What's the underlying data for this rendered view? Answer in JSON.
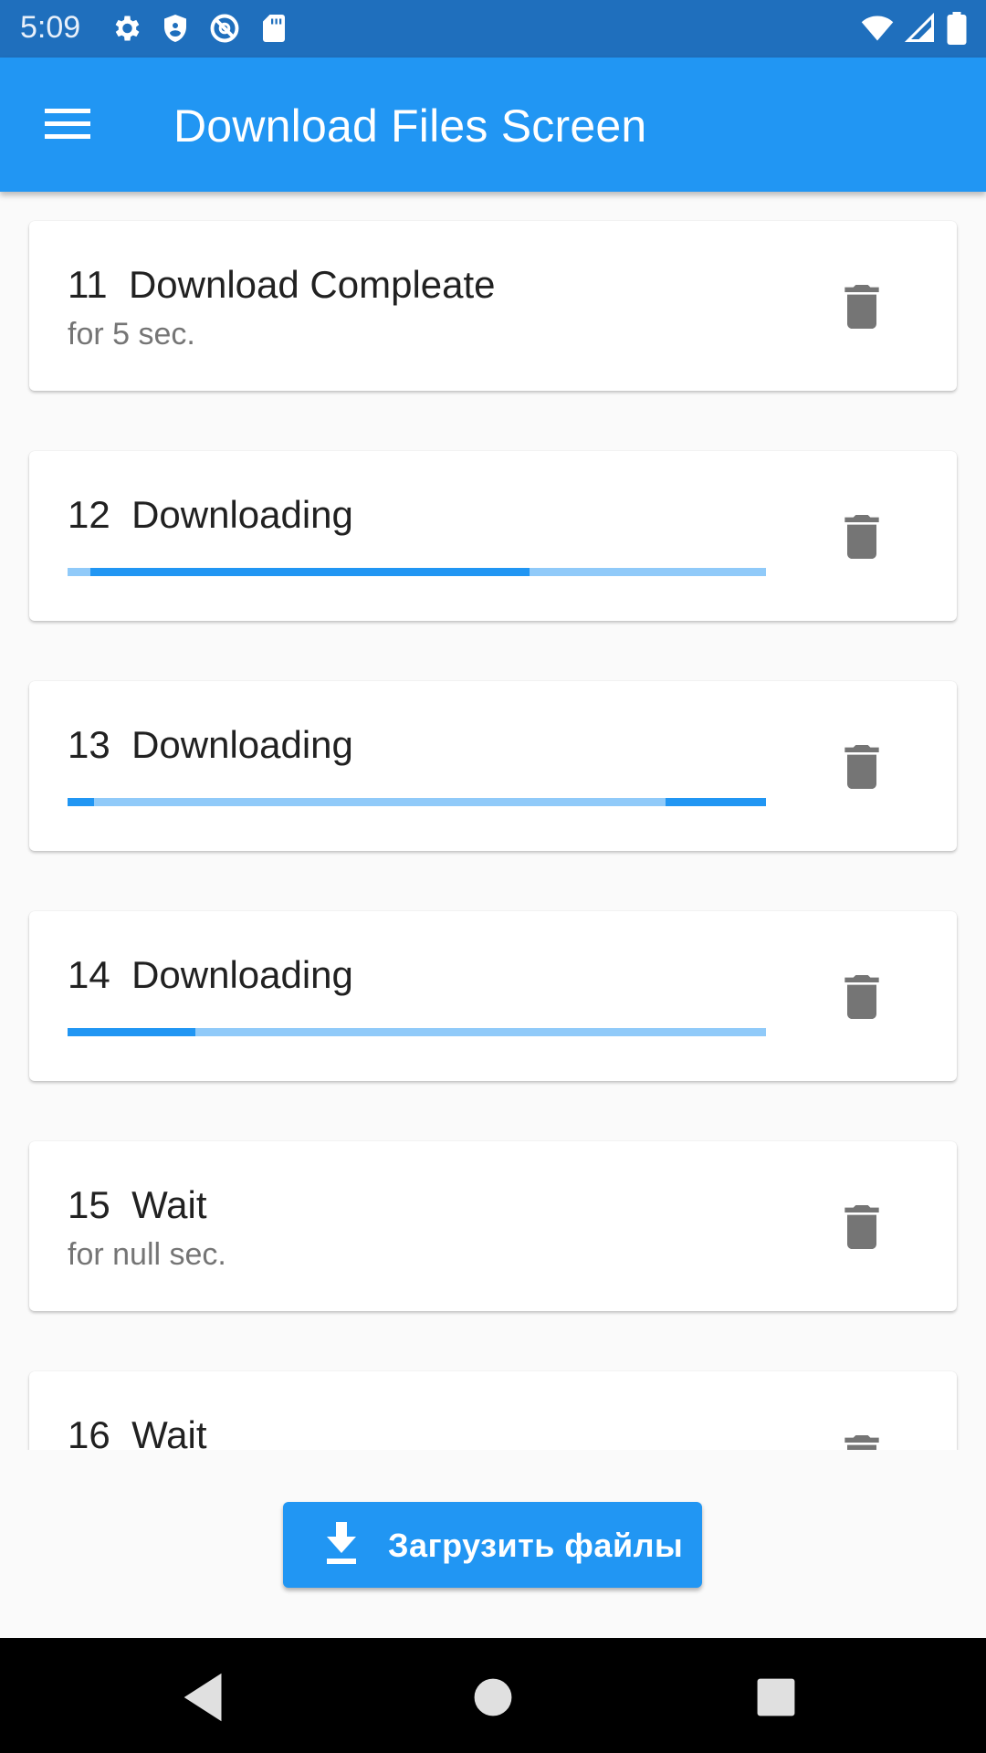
{
  "status_bar": {
    "time": "5:09",
    "icons_left": [
      "settings-icon",
      "shield-icon",
      "do-not-disturb-icon",
      "sd-card-icon"
    ],
    "icons_right": [
      "wifi-icon",
      "cell-signal-icon",
      "battery-icon"
    ]
  },
  "app_bar": {
    "menu_icon": "hamburger-menu-icon",
    "title": "Download Files Screen"
  },
  "colors": {
    "primary": "#2196f3",
    "status_bar": "#1f6fbd",
    "progress_track": "#90caf9",
    "delete_icon": "#757575"
  },
  "items": [
    {
      "number": "11",
      "status": "Download Compleate",
      "subtitle": "for 5 sec."
    },
    {
      "number": "12",
      "status": "Downloading",
      "progress": "indeterminate"
    },
    {
      "number": "13",
      "status": "Downloading",
      "progress": "indeterminate"
    },
    {
      "number": "14",
      "status": "Downloading",
      "progress": "indeterminate"
    },
    {
      "number": "15",
      "status": "Wait",
      "subtitle": "for null sec."
    },
    {
      "number": "16",
      "status": "Wait"
    }
  ],
  "delete_icon": "trash-icon",
  "download_button": {
    "icon": "download-icon",
    "label": "Загрузить файлы"
  },
  "nav_bar": {
    "icons": [
      "back-icon",
      "home-icon",
      "recents-icon"
    ]
  }
}
